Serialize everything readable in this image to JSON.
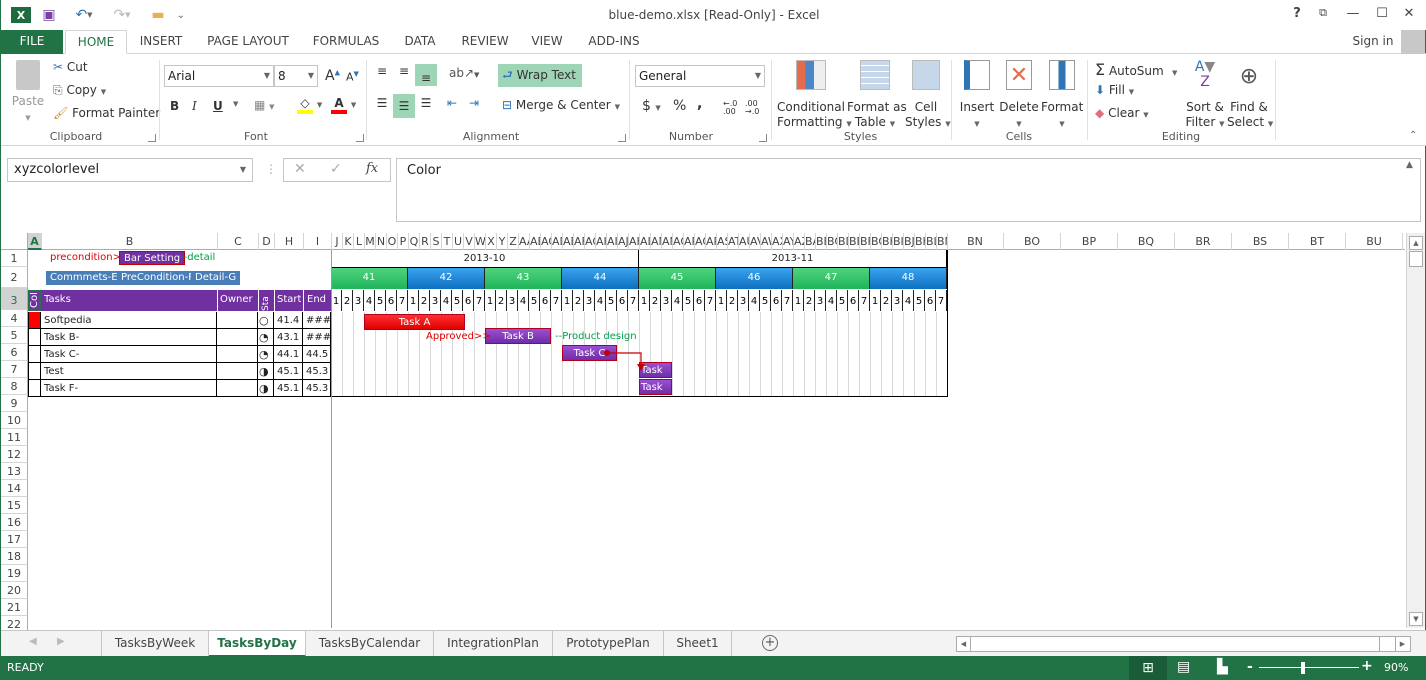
{
  "window": {
    "title": "blue-demo.xlsx  [Read-Only] - Excel",
    "controls": {
      "help": "?",
      "restore_ribbon": "⧉",
      "minimize": "—",
      "maximize": "☐",
      "close": "✕"
    },
    "sign_in": "Sign in"
  },
  "qat": {
    "excel_logo": "X",
    "save": "💾",
    "undo": "↶",
    "redo": "↷",
    "open": "📂",
    "customize": "⌄"
  },
  "ribbon_tabs": [
    "FILE",
    "HOME",
    "INSERT",
    "PAGE LAYOUT",
    "FORMULAS",
    "DATA",
    "REVIEW",
    "VIEW",
    "ADD-INS"
  ],
  "active_ribbon_tab": "HOME",
  "ribbon": {
    "clipboard": {
      "label": "Clipboard",
      "paste": "Paste",
      "cut": "Cut",
      "copy": "Copy",
      "format_painter": "Format Painter"
    },
    "font": {
      "label": "Font",
      "font_name": "Arial",
      "font_size": "8",
      "bold": "B",
      "italic": "I",
      "underline": "U",
      "grow": "A",
      "shrink": "A",
      "highlight_color": "#ffff00",
      "font_color": "#ff0000"
    },
    "alignment": {
      "label": "Alignment",
      "wrap_text": "Wrap Text",
      "merge_center": "Merge & Center"
    },
    "number": {
      "label": "Number",
      "format": "General",
      "currency": "$",
      "percent": "%",
      "comma": ",",
      "inc_decimal": "←.0 .00",
      "dec_decimal": ".00 →.0"
    },
    "styles": {
      "label": "Styles",
      "conditional_formatting": [
        "Conditional",
        "Formatting"
      ],
      "format_as_table": [
        "Format as",
        "Table"
      ],
      "cell_styles": [
        "Cell",
        "Styles"
      ]
    },
    "cells": {
      "label": "Cells",
      "insert": "Insert",
      "delete": "Delete",
      "format": "Format"
    },
    "editing": {
      "label": "Editing",
      "autosum": "AutoSum",
      "fill": "Fill",
      "clear": "Clear",
      "sort_filter": [
        "Sort &",
        "Filter"
      ],
      "find_select": [
        "Find &",
        "Select"
      ]
    }
  },
  "formula_bar": {
    "name_box": "xyzcolorlevel",
    "cancel": "✕",
    "enter": "✓",
    "fx": "fx",
    "content": "Color"
  },
  "columns": [
    "A",
    "B",
    "C",
    "D",
    "H",
    "I",
    "J",
    "K",
    "L",
    "M",
    "N",
    "O",
    "P",
    "Q",
    "R",
    "S",
    "T",
    "U",
    "V",
    "W",
    "X",
    "Y",
    "Z",
    "AA",
    "AB",
    "AC",
    "AD",
    "AE",
    "AF",
    "AG",
    "AH",
    "AI",
    "AJ",
    "AK",
    "AL",
    "AM",
    "AN",
    "AO",
    "AP",
    "AQ",
    "AR",
    "AS",
    "AT",
    "AU",
    "AV",
    "AW",
    "AX",
    "AY",
    "AZ",
    "BA",
    "BB",
    "BC",
    "BD",
    "BE",
    "BF",
    "BG",
    "BH",
    "BI",
    "BJ",
    "BK",
    "BL",
    "BM",
    "BN",
    "BO",
    "BP",
    "BQ",
    "BR",
    "BS",
    "BT",
    "BU"
  ],
  "rows": [
    "1",
    "2",
    "3",
    "4",
    "5",
    "6",
    "7",
    "8",
    "9",
    "10",
    "11",
    "12",
    "13",
    "14",
    "15",
    "16",
    "17",
    "18",
    "19",
    "20",
    "21",
    "22"
  ],
  "sheet": {
    "row1": {
      "precondition": "precondition>>",
      "bar_setting": "Bar Setting",
      "detail": "--detail"
    },
    "row2": {
      "comments": "Commmets-E",
      "precondition_f": "PreCondition-F",
      "detail_g": "Detail-G"
    },
    "header": {
      "col": "Col",
      "tasks": "Tasks",
      "owner": "Owner",
      "status": "Sta",
      "start": "Start",
      "end": "End"
    },
    "tasks": [
      {
        "name": "Softpedia",
        "owner": "",
        "status": "○",
        "start": "41.4",
        "end": "###",
        "color": "#ff0000"
      },
      {
        "name": "Task B-",
        "owner": "",
        "status": "◔",
        "start": "43.1",
        "end": "###",
        "color": ""
      },
      {
        "name": "Task C-",
        "owner": "",
        "status": "◔",
        "start": "44.1",
        "end": "44.5",
        "color": ""
      },
      {
        "name": "Test",
        "owner": "",
        "status": "◑",
        "start": "45.1",
        "end": "45.3",
        "color": ""
      },
      {
        "name": "Task F-",
        "owner": "",
        "status": "◑",
        "start": "45.1",
        "end": "45.3",
        "color": ""
      }
    ],
    "months": [
      "2013-10",
      "2013-11"
    ],
    "weeks": [
      "41",
      "42",
      "43",
      "44",
      "45",
      "46",
      "47",
      "48"
    ],
    "days": [
      "1",
      "2",
      "3",
      "4",
      "5",
      "6",
      "7"
    ],
    "gantt_bars": [
      {
        "label": "Task A",
        "style": "red",
        "week_start": 41,
        "day_start": 4,
        "day_span": 9
      },
      {
        "label": "Task B",
        "style": "purple",
        "week_start": 43,
        "day_start": 1,
        "day_span": 4
      },
      {
        "label": "Task C",
        "style": "purple",
        "week_start": 44,
        "day_start": 1,
        "day_span": 4
      },
      {
        "label": "Task D",
        "style": "purple",
        "week_start": 45,
        "day_start": 1,
        "day_span": 2
      },
      {
        "label": "Task F",
        "style": "purple",
        "week_start": 45,
        "day_start": 1,
        "day_span": 2
      }
    ],
    "annotations": {
      "approved": "Approved>>",
      "product_design": "--Product design"
    }
  },
  "sheet_tabs": [
    "TasksByWeek",
    "TasksByDay",
    "TasksByCalendar",
    "IntegrationPlan",
    "PrototypePlan",
    "Sheet1"
  ],
  "active_sheet": "TasksByDay",
  "add_sheet": "+",
  "status_bar": {
    "mode": "READY",
    "zoom": "90%",
    "zoom_minus": "-",
    "zoom_plus": "+",
    "zoom_level_percent": 90
  }
}
